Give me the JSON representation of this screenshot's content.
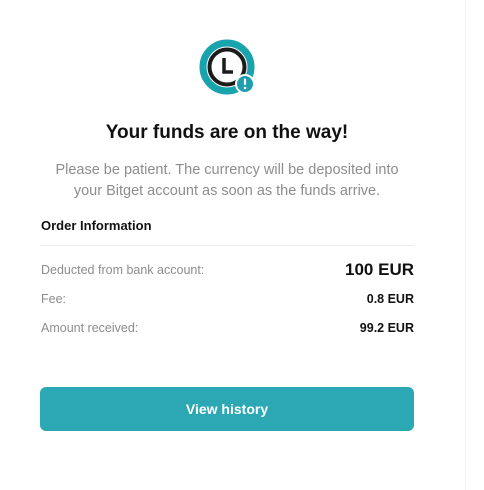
{
  "status": {
    "icon": "clock-alert-icon",
    "title": "Your funds are on the way!",
    "message": "Please be patient. The currency will be deposited into your Bitget account as soon as the funds arrive."
  },
  "order": {
    "section_title": "Order Information",
    "rows": [
      {
        "label": "Deducted from bank account:",
        "value": "100 EUR"
      },
      {
        "label": "Fee:",
        "value": "0.8 EUR"
      },
      {
        "label": "Amount received:",
        "value": "99.2 EUR"
      }
    ]
  },
  "actions": {
    "view_history_label": "View history"
  },
  "colors": {
    "accent": "#2ba8b4",
    "icon_ring": "#19a3ac",
    "icon_dark": "#1b1b1b",
    "muted_text": "#8d8d8d"
  }
}
